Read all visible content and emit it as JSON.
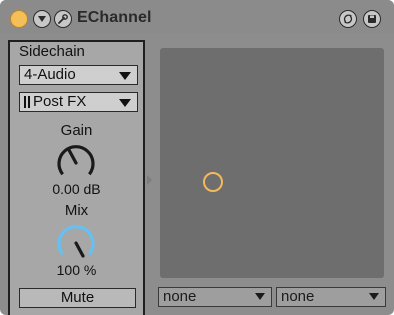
{
  "device": {
    "title": "EChannel",
    "icons": {
      "power": "power-led-icon",
      "fold": "fold-chevron-icon",
      "edit": "wrench-icon",
      "hotswap": "hotswap-icon",
      "save": "save-icon"
    }
  },
  "sidechain": {
    "title": "Sidechain",
    "source": "4-Audio",
    "tap": "Post FX",
    "gain_label": "Gain",
    "gain_value": "0.00 dB",
    "mix_label": "Mix",
    "mix_value": "100 %",
    "mix_level": 1.0,
    "mute_label": "Mute"
  },
  "xy_pad": {
    "x_source": "none",
    "y_source": "none"
  },
  "colors": {
    "power_on": "#f5bf57",
    "knob_ring": "#63c1f3",
    "xy_dot": "#f3b95c",
    "panel_bg": "#a7a7a7",
    "xy_bg": "#6e6e6e"
  }
}
